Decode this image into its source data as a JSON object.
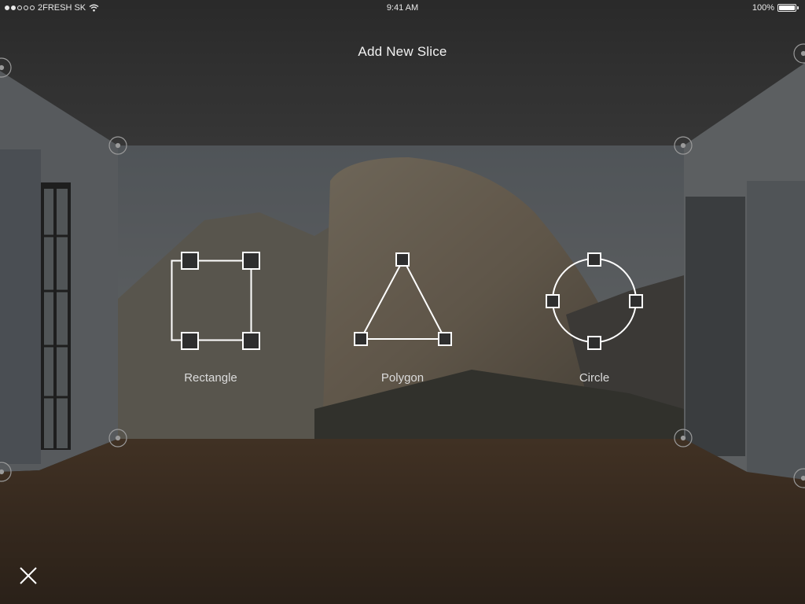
{
  "status_bar": {
    "carrier": "2FRESH SK",
    "time": "9:41 AM",
    "battery": "100%",
    "signal_bars_filled": 2,
    "signal_bars_total": 5,
    "battery_level": 1.0,
    "icons": [
      "wifi-icon",
      "battery-icon"
    ]
  },
  "header": {
    "title": "Add New Slice"
  },
  "options": [
    {
      "label": "Rectangle",
      "icon": "rectangle-shape-icon"
    },
    {
      "label": "Polygon",
      "icon": "polygon-shape-icon"
    },
    {
      "label": "Circle",
      "icon": "circle-shape-icon"
    }
  ],
  "footer": {
    "close_icon": "close-icon"
  },
  "colors": {
    "overlay": "#1e1e1e",
    "icon_stroke": "#ffffff",
    "text": "#f2f2f2",
    "floor": "#4a3220"
  }
}
